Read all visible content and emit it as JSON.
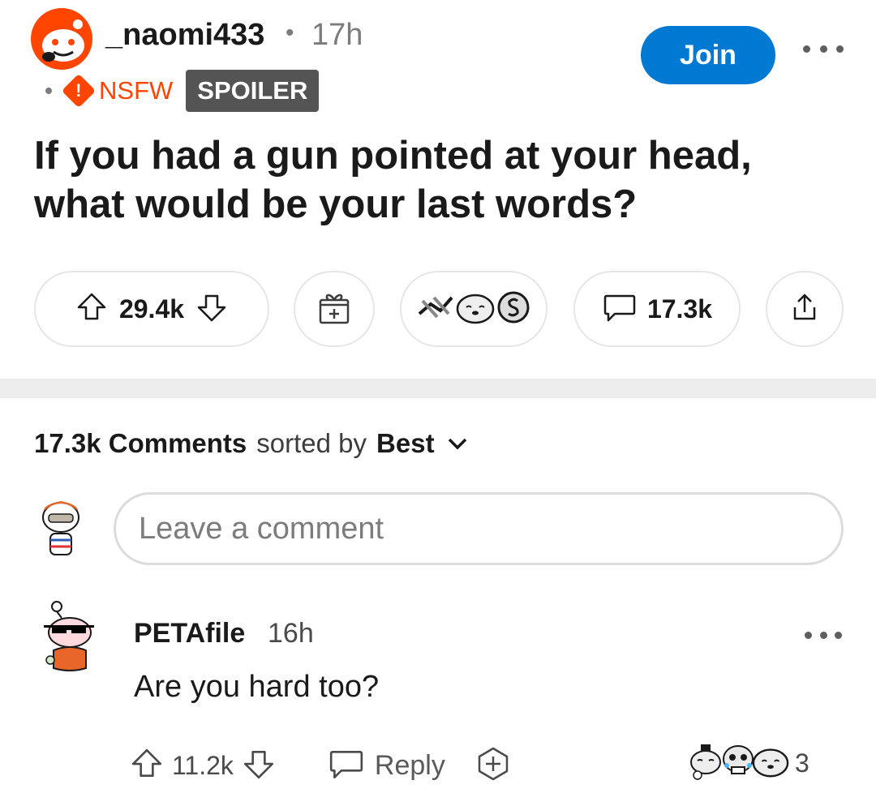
{
  "post": {
    "username": "_naomi433",
    "separator": "•",
    "age": "17h",
    "join_label": "Join",
    "nsfw_label": "NSFW",
    "spoiler_label": "SPOILER",
    "title": "If you had a gun pointed at your head, what would be your last words?",
    "score": "29.4k",
    "comment_count": "17.3k"
  },
  "comments_header": {
    "count": "17.3k Comments",
    "sorted_by": "sorted by",
    "sort_value": "Best"
  },
  "composer": {
    "placeholder": "Leave a comment"
  },
  "comment": {
    "username": "PETAfile",
    "age": "16h",
    "text": "Are you hard too?",
    "score": "11.2k",
    "reply_label": "Reply",
    "award_count": "3"
  },
  "colors": {
    "brand": "#ff4500",
    "join": "#0079d3",
    "spoiler_bg": "#545454"
  }
}
